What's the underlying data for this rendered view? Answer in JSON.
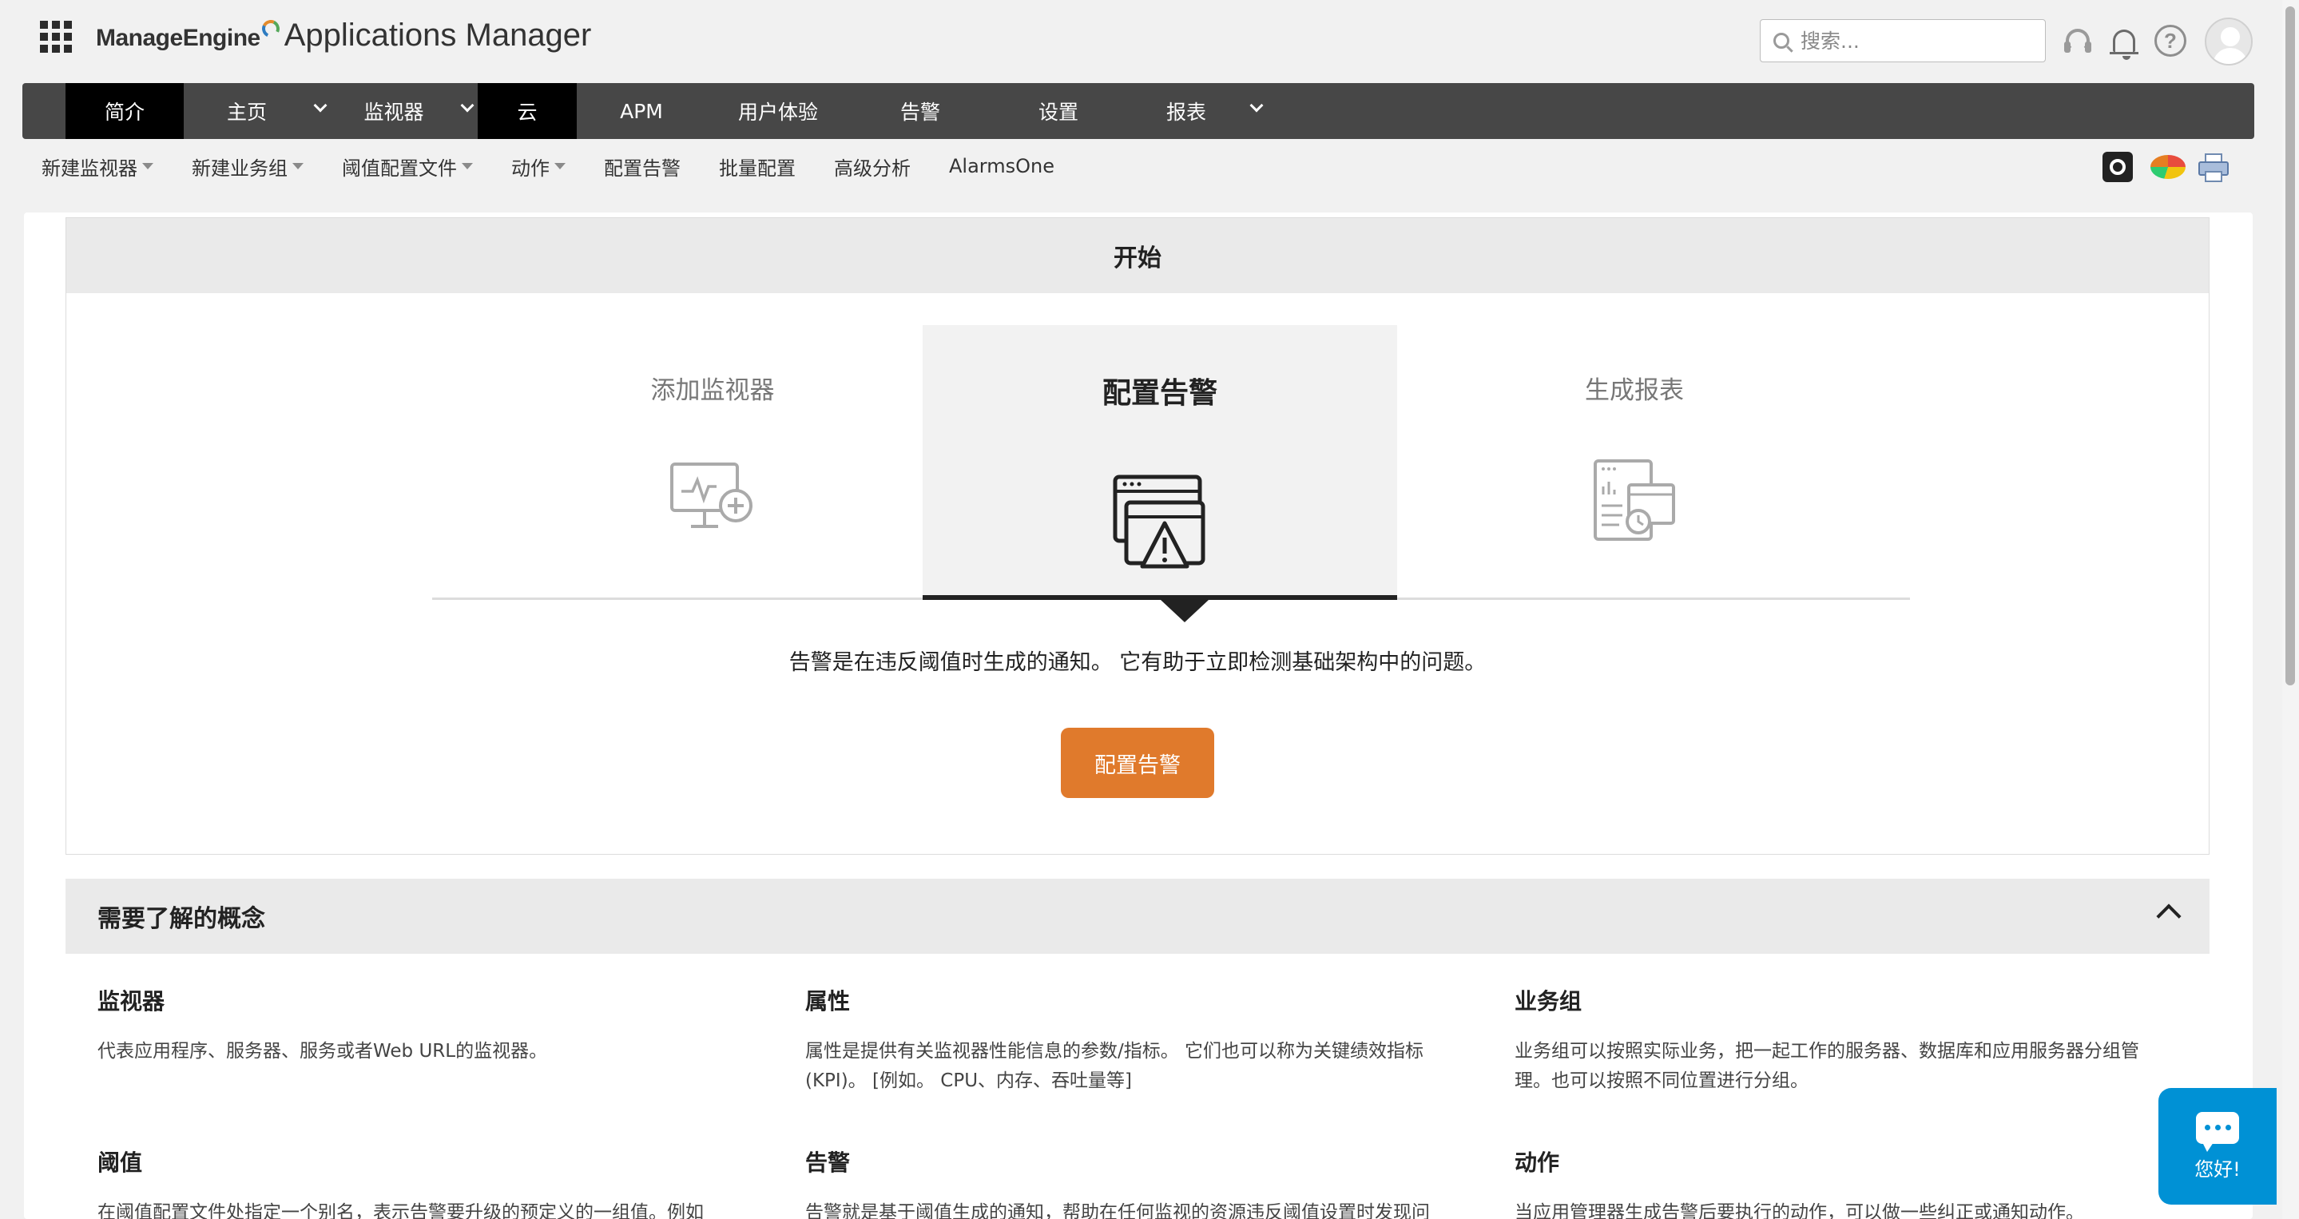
{
  "header": {
    "brand": "ManageEngine",
    "product": "Applications Manager",
    "search_placeholder": "搜索...",
    "icons": [
      "apps-grid-icon",
      "headset-icon",
      "bell-icon",
      "help-icon",
      "avatar"
    ]
  },
  "mainnav": {
    "items": [
      {
        "label": "简介",
        "dropdown": false,
        "active": true
      },
      {
        "label": "主页",
        "dropdown": true,
        "active": false
      },
      {
        "label": "监视器",
        "dropdown": true,
        "active": false
      },
      {
        "label": "云",
        "dropdown": false,
        "active": true
      },
      {
        "label": "APM",
        "dropdown": false,
        "active": false
      },
      {
        "label": "用户体验",
        "dropdown": false,
        "active": false
      },
      {
        "label": "告警",
        "dropdown": false,
        "active": false
      },
      {
        "label": "设置",
        "dropdown": false,
        "active": false
      },
      {
        "label": "报表",
        "dropdown": true,
        "active": false
      }
    ]
  },
  "subnav": {
    "items": [
      {
        "label": "新建监视器",
        "dropdown": true
      },
      {
        "label": "新建业务组",
        "dropdown": true
      },
      {
        "label": "阈值配置文件",
        "dropdown": true
      },
      {
        "label": "动作",
        "dropdown": true
      },
      {
        "label": "配置告警",
        "dropdown": false
      },
      {
        "label": "批量配置",
        "dropdown": false
      },
      {
        "label": "高级分析",
        "dropdown": false
      },
      {
        "label": "AlarmsOne",
        "dropdown": false
      }
    ],
    "tool_icons": [
      "camera-icon",
      "pie-chart-icon",
      "printer-icon"
    ]
  },
  "getting_started": {
    "title": "开始",
    "steps": [
      {
        "label": "添加监视器",
        "icon": "monitor-add-icon",
        "active": false
      },
      {
        "label": "配置告警",
        "icon": "alarm-windows-icon",
        "active": true
      },
      {
        "label": "生成报表",
        "icon": "report-icon",
        "active": false
      }
    ],
    "description": "告警是在违反阈值时生成的通知。 它有助于立即检测基础架构中的问题。",
    "button_label": "配置告警"
  },
  "concepts": {
    "title": "需要了解的概念",
    "items": [
      {
        "title": "监视器",
        "desc": "代表应用程序、服务器、服务或者Web URL的监视器。"
      },
      {
        "title": "属性",
        "desc": "属性是提供有关监视器性能信息的参数/指标。 它们也可以称为关键绩效指标 (KPI)。 [例如。 CPU、内存、吞吐量等]"
      },
      {
        "title": "业务组",
        "desc": "业务组可以按照实际业务，把一起工作的服务器、数据库和应用服务器分组管理。也可以按照不同位置进行分组。"
      },
      {
        "title": "阈值",
        "desc": "在阈值配置文件处指定一个别名，表示告警要升级的预定义的一组值。例如"
      },
      {
        "title": "告警",
        "desc": "告警就是基于阈值生成的通知，帮助在任何监视的资源违反阈值设置时发现问"
      },
      {
        "title": "动作",
        "desc": "当应用管理器生成告警后要执行的动作，可以做一些纠正或通知动作。"
      }
    ]
  },
  "chat": {
    "label": "您好!"
  },
  "colors": {
    "nav_bg": "#474747",
    "nav_active": "#000000",
    "accent_button": "#e07a2c",
    "chat": "#0091d5"
  }
}
